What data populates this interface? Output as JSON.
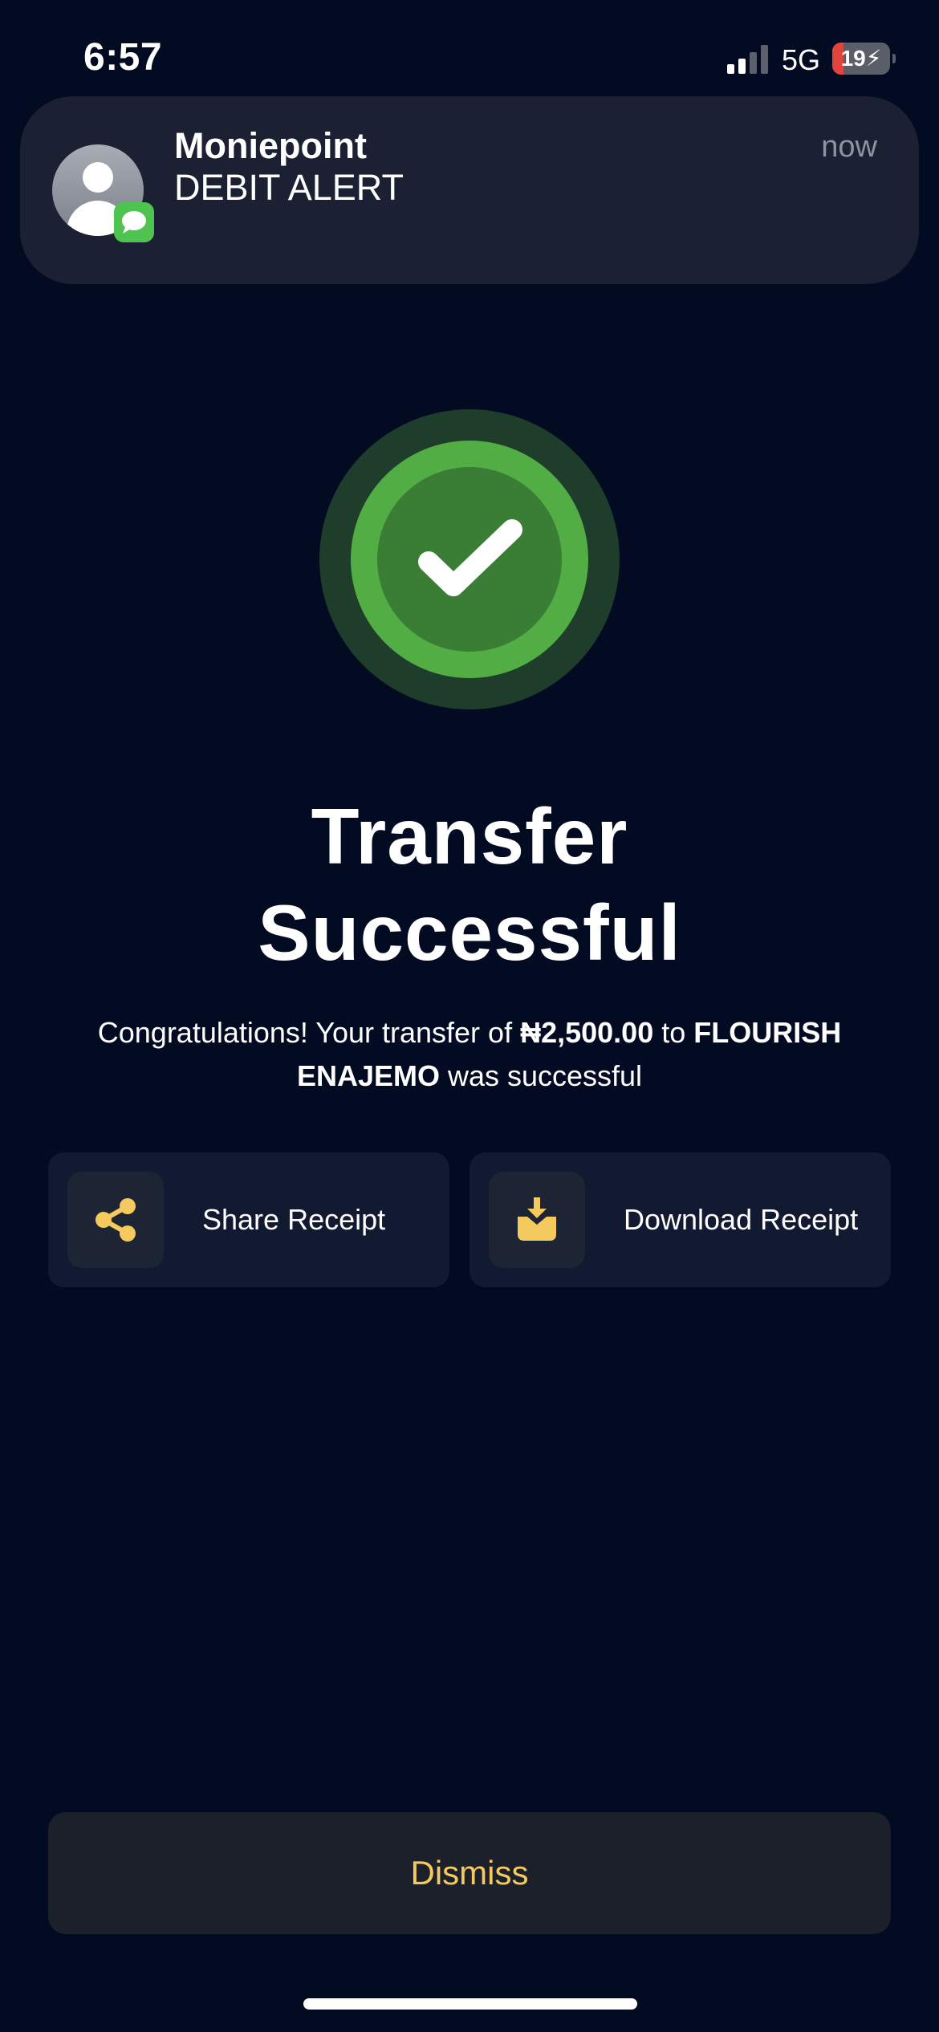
{
  "status_bar": {
    "time": "6:57",
    "network": "5G",
    "battery_level": "19",
    "battery_fraction": 0.19,
    "signal_bars_active": 2,
    "signal_bars_total": 4
  },
  "notification": {
    "app_name": "Moniepoint",
    "message": "DEBIT ALERT",
    "time": "now",
    "icon": "person-avatar-icon",
    "badge_icon": "messages-app-icon"
  },
  "success": {
    "icon": "checkmark-icon",
    "title_line1": "Transfer",
    "title_line2": "Successful",
    "message_prefix": "Congratulations! Your transfer of ",
    "amount": "₦2,500.00",
    "message_middle": " to ",
    "recipient": "FLOURISH ENAJEMO",
    "message_suffix": " was successful"
  },
  "actions": {
    "share_label": "Share Receipt",
    "share_icon": "share-icon",
    "download_label": "Download Receipt",
    "download_icon": "download-icon"
  },
  "dismiss_label": "Dismiss",
  "colors": {
    "background": "#030b22",
    "accent": "#f4c95d",
    "success_green": "#52ad45",
    "success_inner": "#3a7d35",
    "success_halo": "#1f3d2b"
  }
}
